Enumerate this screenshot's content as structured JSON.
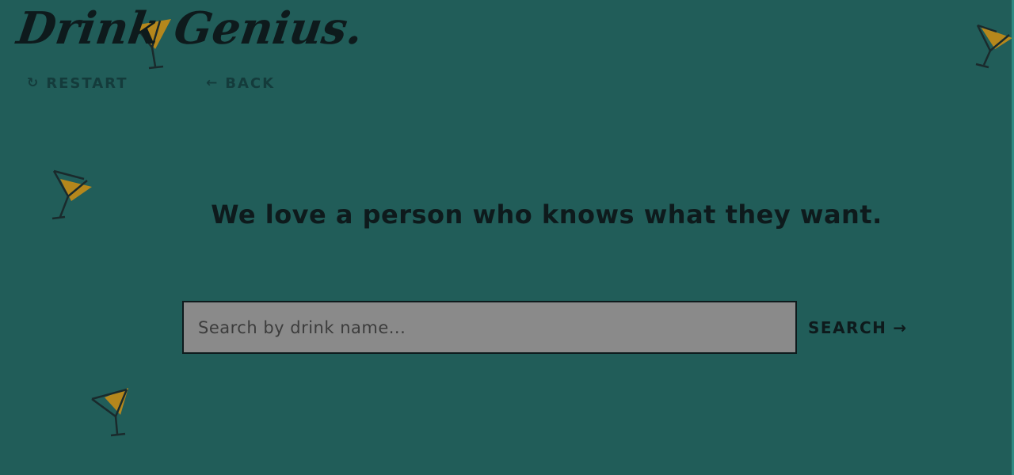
{
  "brand": {
    "logo_text": "Drink Genius."
  },
  "nav": {
    "restart": {
      "icon": "restart-icon",
      "label": "RESTART"
    },
    "back": {
      "icon": "arrow-left-icon",
      "label": "BACK"
    }
  },
  "main": {
    "headline": "We love a person who knows what they want.",
    "search": {
      "placeholder": "Search by drink name...",
      "value": "",
      "button_label": "SEARCH",
      "button_icon": "arrow-right-icon"
    }
  },
  "decorations": {
    "icon": "martini-glass-icon",
    "glass_color": "#1a2a2c",
    "drink_color": "#b5871c"
  },
  "colors": {
    "background": "#215d59",
    "input_background": "#8a8a8a",
    "text": "#0e1a1c",
    "nav_text": "#143b3b"
  }
}
